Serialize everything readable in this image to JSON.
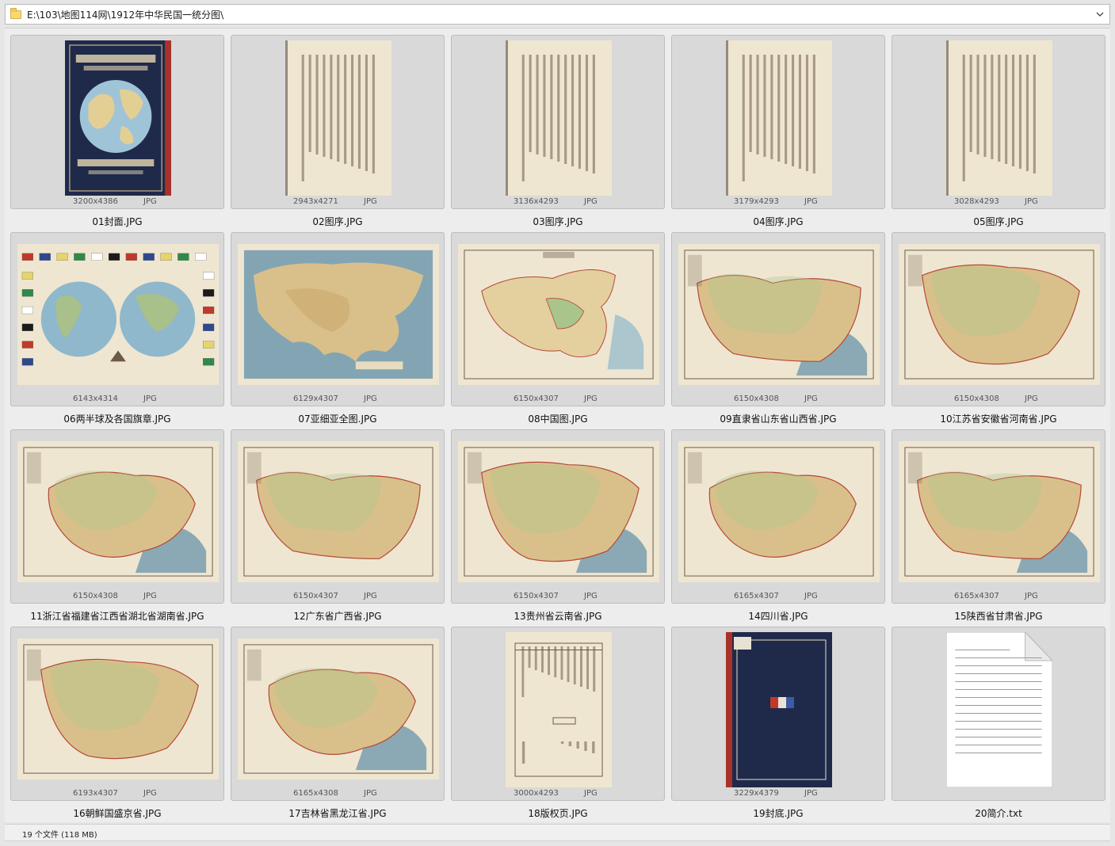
{
  "address": {
    "path": "E:\\103\\地图114网\\1912年中华民国一统分图\\"
  },
  "files": [
    {
      "name": "01封面.JPG",
      "dims": "3200x4386",
      "type": "JPG",
      "thumb": "cover-front"
    },
    {
      "name": "02图序.JPG",
      "dims": "2943x4271",
      "type": "JPG",
      "thumb": "text-page"
    },
    {
      "name": "03图序.JPG",
      "dims": "3136x4293",
      "type": "JPG",
      "thumb": "text-page"
    },
    {
      "name": "04图序.JPG",
      "dims": "3179x4293",
      "type": "JPG",
      "thumb": "text-page"
    },
    {
      "name": "05图序.JPG",
      "dims": "3028x4293",
      "type": "JPG",
      "thumb": "text-page"
    },
    {
      "name": "06两半球及各国旗章.JPG",
      "dims": "6143x4314",
      "type": "JPG",
      "thumb": "hemispheres-map"
    },
    {
      "name": "07亚细亚全图.JPG",
      "dims": "6129x4307",
      "type": "JPG",
      "thumb": "asia-map"
    },
    {
      "name": "08中国图.JPG",
      "dims": "6150x4307",
      "type": "JPG",
      "thumb": "china-map"
    },
    {
      "name": "09直隶省山东省山西省.JPG",
      "dims": "6150x4308",
      "type": "JPG",
      "thumb": "province-map"
    },
    {
      "name": "10江苏省安徽省河南省.JPG",
      "dims": "6150x4308",
      "type": "JPG",
      "thumb": "province-map"
    },
    {
      "name": "11浙江省福建省江西省湖北省湖南省.JPG",
      "dims": "6150x4308",
      "type": "JPG",
      "thumb": "province-map"
    },
    {
      "name": "12广东省广西省.JPG",
      "dims": "6150x4307",
      "type": "JPG",
      "thumb": "province-map"
    },
    {
      "name": "13贵州省云南省.JPG",
      "dims": "6150x4307",
      "type": "JPG",
      "thumb": "province-map"
    },
    {
      "name": "14四川省.JPG",
      "dims": "6165x4307",
      "type": "JPG",
      "thumb": "province-map"
    },
    {
      "name": "15陕西省甘肃省.JPG",
      "dims": "6165x4307",
      "type": "JPG",
      "thumb": "province-map"
    },
    {
      "name": "16朝鲜国盛京省.JPG",
      "dims": "6193x4307",
      "type": "JPG",
      "thumb": "province-map"
    },
    {
      "name": "17吉林省黑龙江省.JPG",
      "dims": "6165x4308",
      "type": "JPG",
      "thumb": "province-map"
    },
    {
      "name": "18版权页.JPG",
      "dims": "3000x4293",
      "type": "JPG",
      "thumb": "copyright-page"
    },
    {
      "name": "19封底.JPG",
      "dims": "3229x4379",
      "type": "JPG",
      "thumb": "cover-back"
    },
    {
      "name": "20简介.txt",
      "dims": "",
      "type": "",
      "thumb": "text-document-icon"
    }
  ],
  "status": {
    "summary": "19 个文件 (118 MB)"
  },
  "colors": {
    "window_bg": "#e6e6e6",
    "tile_bg": "#d9d9d9",
    "paper": "#efe6d1",
    "map_sea": "#5f8fa8",
    "map_land": "#d9c08a",
    "cover_navy": "#1f2a4a",
    "cover_red": "#a8322b"
  }
}
